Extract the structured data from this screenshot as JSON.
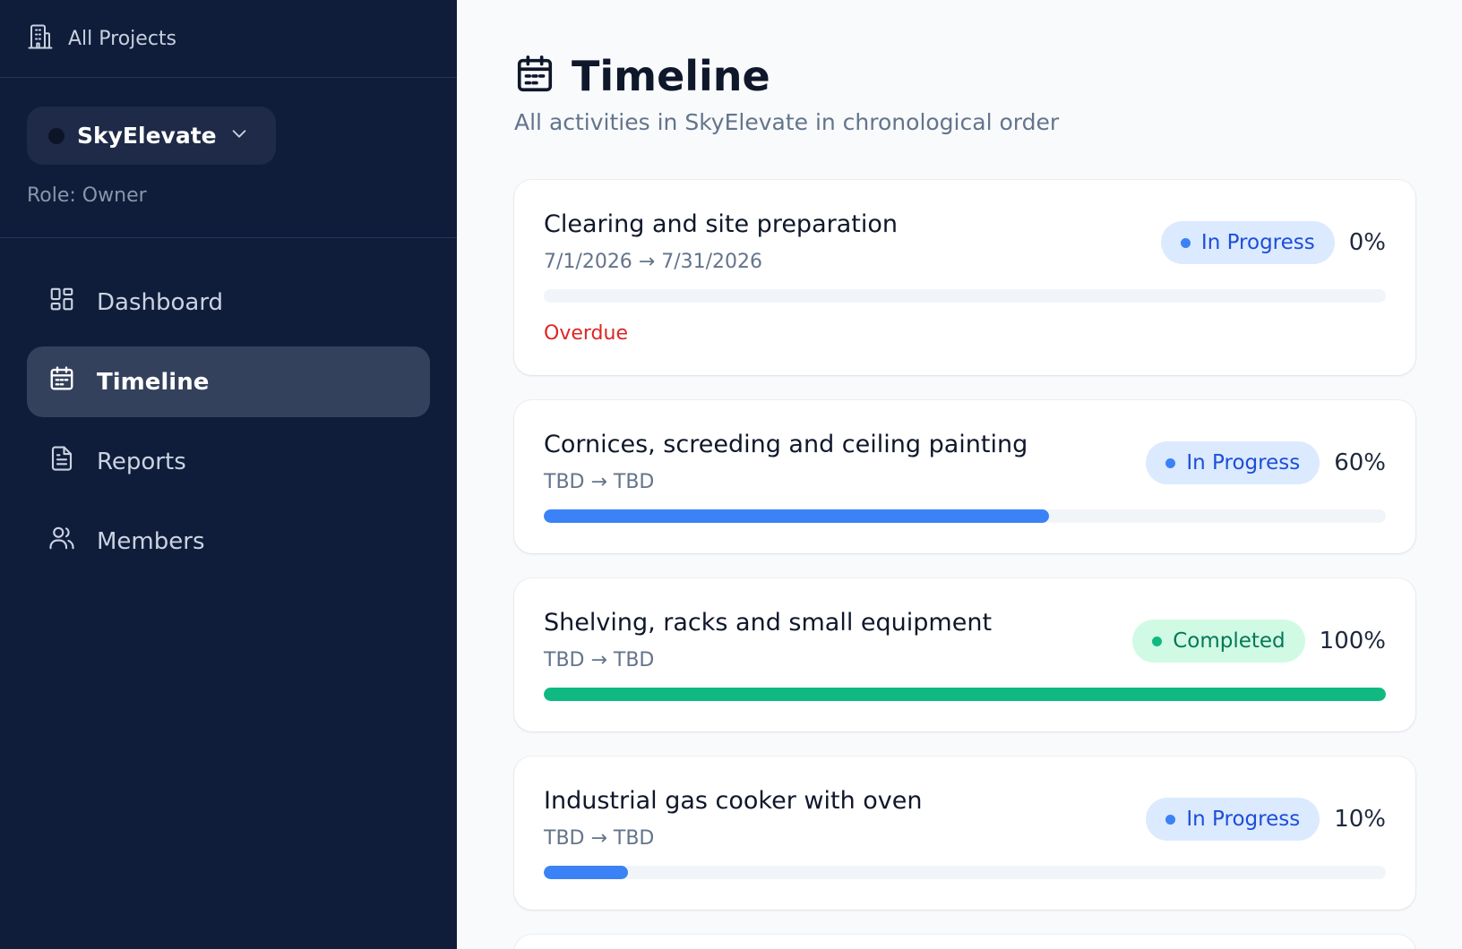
{
  "sidebar": {
    "all_projects": "All Projects",
    "project_name": "SkyElevate",
    "role": "Role: Owner",
    "nav": [
      {
        "label": "Dashboard",
        "icon": "dashboard-icon",
        "active": false
      },
      {
        "label": "Timeline",
        "icon": "calendar-icon",
        "active": true
      },
      {
        "label": "Reports",
        "icon": "document-icon",
        "active": false
      },
      {
        "label": "Members",
        "icon": "users-icon",
        "active": false
      }
    ]
  },
  "main": {
    "title": "Timeline",
    "subtitle": "All activities in SkyElevate in chronological order",
    "activities": [
      {
        "name": "Clearing and site preparation",
        "dates": "7/1/2026 → 7/31/2026",
        "status": "In Progress",
        "percent_label": "0%",
        "progress": 0,
        "note": "Overdue"
      },
      {
        "name": "Cornices, screeding and ceiling painting",
        "dates": "TBD → TBD",
        "status": "In Progress",
        "percent_label": "60%",
        "progress": 60,
        "note": ""
      },
      {
        "name": "Shelving, racks and small equipment",
        "dates": "TBD → TBD",
        "status": "Completed",
        "percent_label": "100%",
        "progress": 100,
        "note": ""
      },
      {
        "name": "Industrial gas cooker with oven",
        "dates": "TBD → TBD",
        "status": "In Progress",
        "percent_label": "10%",
        "progress": 10,
        "note": ""
      }
    ]
  },
  "colors": {
    "sidebar_bg": "#0f1d3b",
    "progress_blue": "#3b82f6",
    "completed_green": "#10b981",
    "overdue_red": "#dc2626"
  }
}
